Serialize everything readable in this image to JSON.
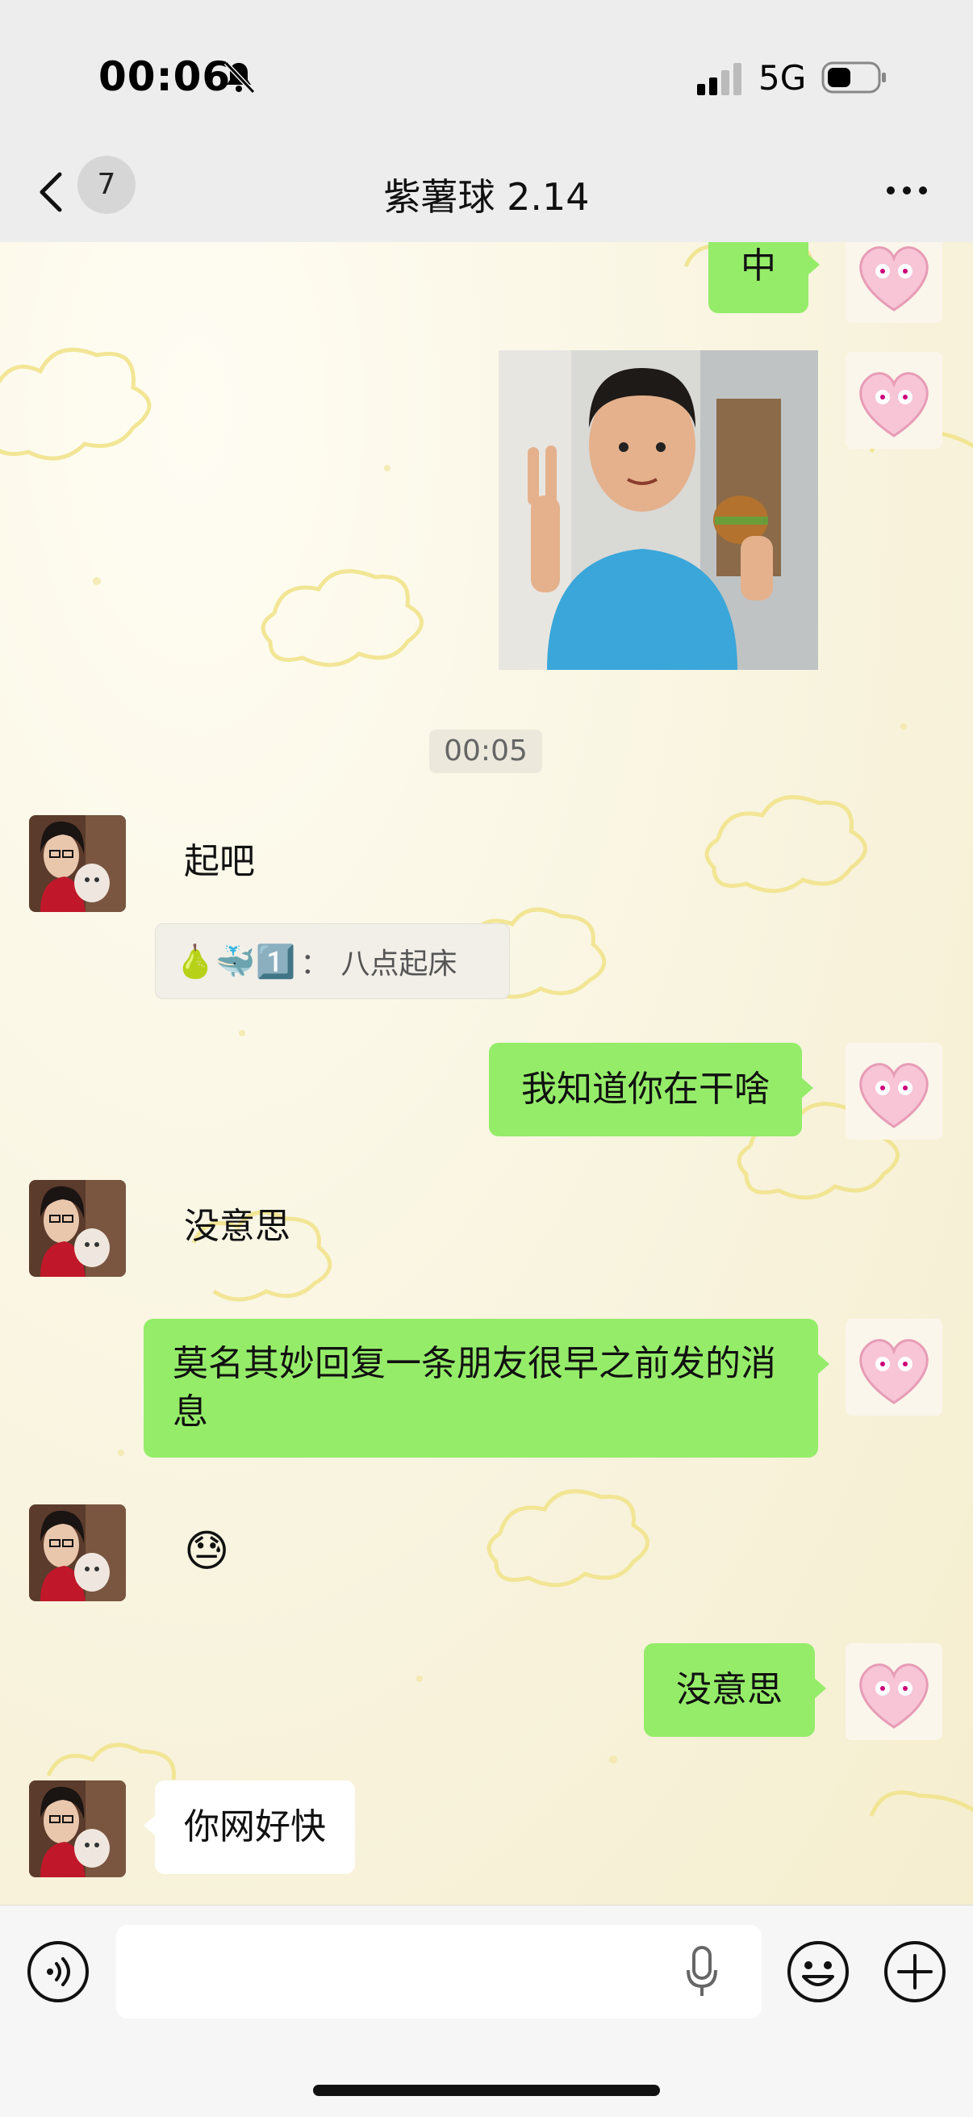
{
  "status_bar": {
    "time": "00:06",
    "network": "5G",
    "icons": [
      "bell-slash-icon",
      "signal-icon",
      "battery-icon"
    ]
  },
  "nav": {
    "unread_count": "7",
    "title": "紫薯球 2.14",
    "icons": [
      "chevron-left-icon",
      "more-icon"
    ]
  },
  "colors": {
    "bubble_green": "#95ec69",
    "bubble_white": "#ffffff",
    "nav_bg": "#ededed",
    "chat_bg": "#f7f3e0",
    "cloud_outline": "#f0e08a"
  },
  "messages": [
    {
      "side": "right",
      "type": "text",
      "text": "中"
    },
    {
      "side": "right",
      "type": "image",
      "image": "photo-man-peace-sign-burger"
    },
    {
      "type": "timestamp",
      "text": "00:05"
    },
    {
      "side": "left",
      "type": "text",
      "text": "起吧"
    },
    {
      "type": "quote",
      "emoji": "🍐🐳1️⃣",
      "separator": "：",
      "text": "八点起床"
    },
    {
      "side": "right",
      "type": "text",
      "text": "我知道你在干啥"
    },
    {
      "side": "left",
      "type": "text",
      "text": "没意思"
    },
    {
      "side": "right",
      "type": "text",
      "text": "莫名其妙回复一条朋友很早之前发的消息"
    },
    {
      "side": "left",
      "type": "emoji",
      "text": "😓"
    },
    {
      "side": "right",
      "type": "text",
      "text": "没意思"
    },
    {
      "side": "left",
      "type": "text",
      "text": "你网好快"
    }
  ],
  "input_bar": {
    "placeholder": "",
    "icons": [
      "voice-icon",
      "microphone-icon",
      "emoji-icon",
      "plus-icon"
    ]
  }
}
